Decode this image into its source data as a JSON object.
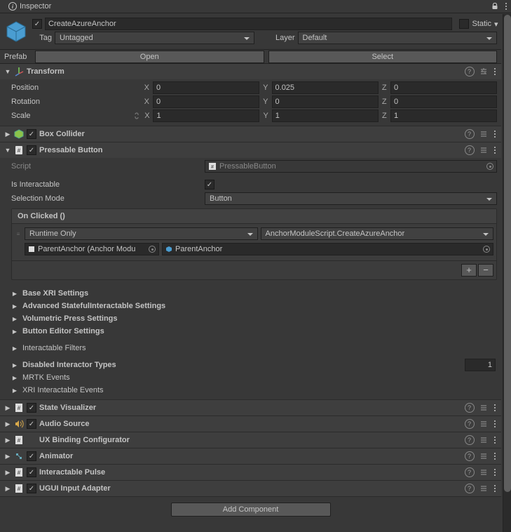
{
  "tab": {
    "title": "Inspector"
  },
  "header": {
    "enabled": true,
    "name": "CreateAzureAnchor",
    "static_label": "Static",
    "static_checked": false,
    "tag_label": "Tag",
    "tag_value": "Untagged",
    "layer_label": "Layer",
    "layer_value": "Default",
    "prefab_label": "Prefab",
    "open_btn": "Open",
    "select_btn": "Select"
  },
  "transform": {
    "title": "Transform",
    "position": {
      "label": "Position",
      "x": "0",
      "y": "0.025",
      "z": "0"
    },
    "rotation": {
      "label": "Rotation",
      "x": "0",
      "y": "0",
      "z": "0"
    },
    "scale": {
      "label": "Scale",
      "x": "1",
      "y": "1",
      "z": "1"
    },
    "axes": {
      "x": "X",
      "y": "Y",
      "z": "Z"
    }
  },
  "box_collider": {
    "title": "Box Collider",
    "enabled": true
  },
  "pressable": {
    "title": "Pressable Button",
    "enabled": true,
    "script_label": "Script",
    "script_value": "PressableButton",
    "is_interactable_label": "Is Interactable",
    "is_interactable": true,
    "selection_mode_label": "Selection Mode",
    "selection_mode_value": "Button",
    "on_clicked_label": "On Clicked ()",
    "runtime": "Runtime Only",
    "func": "AnchorModuleScript.CreateAzureAnchor",
    "target": "ParentAnchor (Anchor Modu",
    "arg": "ParentAnchor"
  },
  "foldouts": {
    "base_xri": "Base XRI Settings",
    "adv_stateful": "Advanced StatefulInteractable Settings",
    "vol_press": "Volumetric Press Settings",
    "btn_editor": "Button Editor Settings",
    "inter_filters": "Interactable Filters",
    "disabled_types": "Disabled Interactor Types",
    "disabled_count": "1",
    "mrtk_events": "MRTK Events",
    "xri_events": "XRI Interactable Events"
  },
  "comps": {
    "state_vis": "State Visualizer",
    "audio": "Audio Source",
    "ux_bind": "UX Binding Configurator",
    "animator": "Animator",
    "pulse": "Interactable Pulse",
    "ugui": "UGUI Input Adapter"
  },
  "add_component": "Add Component"
}
